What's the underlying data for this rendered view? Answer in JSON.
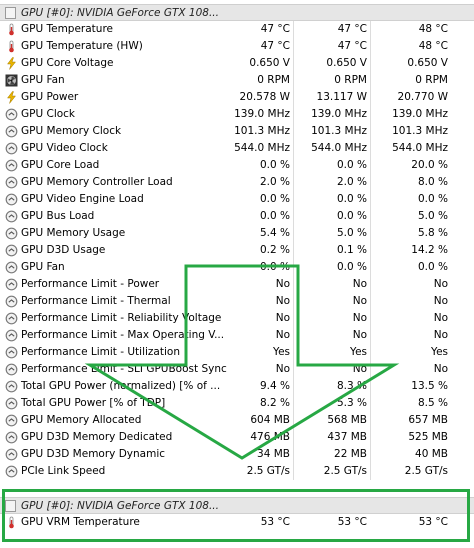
{
  "panel1": {
    "header": "GPU [#0]: NVIDIA GeForce GTX 108...",
    "rows": [
      {
        "icon": "thermometer-icon",
        "label": "GPU Temperature",
        "values": [
          "47 °C",
          "47 °C",
          "48 °C"
        ]
      },
      {
        "icon": "thermometer-icon",
        "label": "GPU Temperature (HW)",
        "values": [
          "47 °C",
          "47 °C",
          "48 °C"
        ]
      },
      {
        "icon": "lightning-icon",
        "label": "GPU Core Voltage",
        "values": [
          "0.650 V",
          "0.650 V",
          "0.650 V"
        ]
      },
      {
        "icon": "fan-icon",
        "label": "GPU Fan",
        "values": [
          "0 RPM",
          "0 RPM",
          "0 RPM"
        ]
      },
      {
        "icon": "lightning-icon",
        "label": "GPU Power",
        "values": [
          "20.578 W",
          "13.117 W",
          "20.770 W"
        ]
      },
      {
        "icon": "clock-icon",
        "label": "GPU Clock",
        "values": [
          "139.0 MHz",
          "139.0 MHz",
          "139.0 MHz"
        ]
      },
      {
        "icon": "clock-icon",
        "label": "GPU Memory Clock",
        "values": [
          "101.3 MHz",
          "101.3 MHz",
          "101.3 MHz"
        ]
      },
      {
        "icon": "clock-icon",
        "label": "GPU Video Clock",
        "values": [
          "544.0 MHz",
          "544.0 MHz",
          "544.0 MHz"
        ]
      },
      {
        "icon": "clock-icon",
        "label": "GPU Core Load",
        "values": [
          "0.0 %",
          "0.0 %",
          "20.0 %"
        ]
      },
      {
        "icon": "clock-icon",
        "label": "GPU Memory Controller Load",
        "values": [
          "2.0 %",
          "2.0 %",
          "8.0 %"
        ]
      },
      {
        "icon": "clock-icon",
        "label": "GPU Video Engine Load",
        "values": [
          "0.0 %",
          "0.0 %",
          "0.0 %"
        ]
      },
      {
        "icon": "clock-icon",
        "label": "GPU Bus Load",
        "values": [
          "0.0 %",
          "0.0 %",
          "5.0 %"
        ]
      },
      {
        "icon": "clock-icon",
        "label": "GPU Memory Usage",
        "values": [
          "5.4 %",
          "5.0 %",
          "5.8 %"
        ]
      },
      {
        "icon": "clock-icon",
        "label": "GPU D3D Usage",
        "values": [
          "0.2 %",
          "0.1 %",
          "14.2 %"
        ]
      },
      {
        "icon": "clock-icon",
        "label": "GPU Fan",
        "values": [
          "0.0 %",
          "0.0 %",
          "0.0 %"
        ]
      },
      {
        "icon": "clock-icon",
        "label": "Performance Limit - Power",
        "values": [
          "No",
          "No",
          "No"
        ]
      },
      {
        "icon": "clock-icon",
        "label": "Performance Limit - Thermal",
        "values": [
          "No",
          "No",
          "No"
        ]
      },
      {
        "icon": "clock-icon",
        "label": "Performance Limit - Reliability Voltage",
        "values": [
          "No",
          "No",
          "No"
        ]
      },
      {
        "icon": "clock-icon",
        "label": "Performance Limit - Max Operating V...",
        "values": [
          "No",
          "No",
          "No"
        ]
      },
      {
        "icon": "clock-icon",
        "label": "Performance Limit - Utilization",
        "values": [
          "Yes",
          "Yes",
          "Yes"
        ]
      },
      {
        "icon": "clock-icon",
        "label": "Performance Limit - SLI GPUBoost Sync",
        "values": [
          "No",
          "No",
          "No"
        ]
      },
      {
        "icon": "clock-icon",
        "label": "Total GPU Power (normalized) [% of ...",
        "values": [
          "9.4 %",
          "8.3 %",
          "13.5 %"
        ]
      },
      {
        "icon": "clock-icon",
        "label": "Total GPU Power [% of TDP]",
        "values": [
          "8.2 %",
          "5.3 %",
          "8.5 %"
        ]
      },
      {
        "icon": "clock-icon",
        "label": "GPU Memory Allocated",
        "values": [
          "604 MB",
          "568 MB",
          "657 MB"
        ]
      },
      {
        "icon": "clock-icon",
        "label": "GPU D3D Memory Dedicated",
        "values": [
          "476 MB",
          "437 MB",
          "525 MB"
        ]
      },
      {
        "icon": "clock-icon",
        "label": "GPU D3D Memory Dynamic",
        "values": [
          "34 MB",
          "22 MB",
          "40 MB"
        ]
      },
      {
        "icon": "clock-icon",
        "label": "PCIe Link Speed",
        "values": [
          "2.5 GT/s",
          "2.5 GT/s",
          "2.5 GT/s"
        ]
      }
    ]
  },
  "panel2": {
    "header": "GPU [#0]: NVIDIA GeForce GTX 108...",
    "rows": [
      {
        "icon": "thermometer-icon",
        "label": "GPU VRM Temperature",
        "values": [
          "53 °C",
          "53 °C",
          "53 °C"
        ]
      }
    ]
  },
  "colors": {
    "annotation": "#27a844",
    "header_bg": "#e6e6e6",
    "thermometer": "#d0302c",
    "lightning": "#e8b400",
    "clock_ring": "#7a7a7a"
  },
  "annotations": {
    "arrow": "down-arrow-annotation",
    "box": "highlight-box-annotation"
  }
}
